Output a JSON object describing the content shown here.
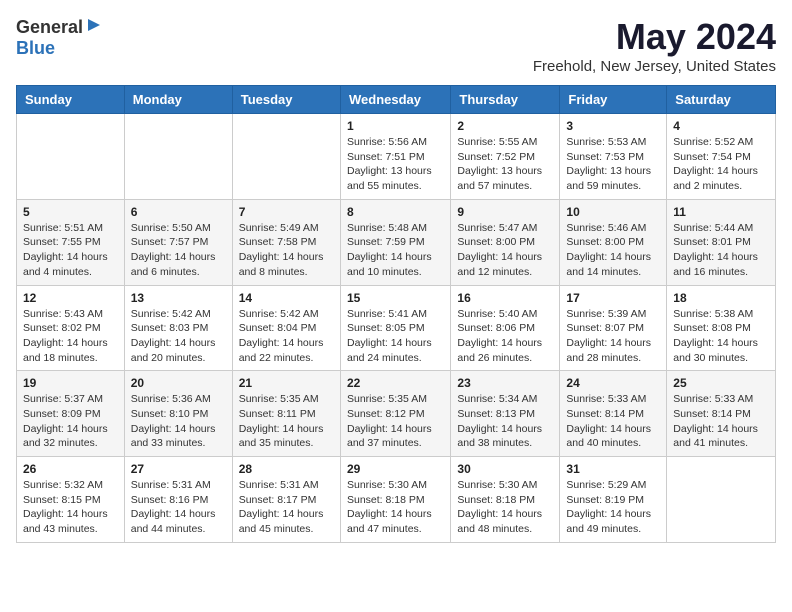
{
  "logo": {
    "general": "General",
    "blue": "Blue"
  },
  "title": "May 2024",
  "subtitle": "Freehold, New Jersey, United States",
  "weekdays": [
    "Sunday",
    "Monday",
    "Tuesday",
    "Wednesday",
    "Thursday",
    "Friday",
    "Saturday"
  ],
  "weeks": [
    [
      {
        "day": "",
        "info": ""
      },
      {
        "day": "",
        "info": ""
      },
      {
        "day": "",
        "info": ""
      },
      {
        "day": "1",
        "info": "Sunrise: 5:56 AM\nSunset: 7:51 PM\nDaylight: 13 hours\nand 55 minutes."
      },
      {
        "day": "2",
        "info": "Sunrise: 5:55 AM\nSunset: 7:52 PM\nDaylight: 13 hours\nand 57 minutes."
      },
      {
        "day": "3",
        "info": "Sunrise: 5:53 AM\nSunset: 7:53 PM\nDaylight: 13 hours\nand 59 minutes."
      },
      {
        "day": "4",
        "info": "Sunrise: 5:52 AM\nSunset: 7:54 PM\nDaylight: 14 hours\nand 2 minutes."
      }
    ],
    [
      {
        "day": "5",
        "info": "Sunrise: 5:51 AM\nSunset: 7:55 PM\nDaylight: 14 hours\nand 4 minutes."
      },
      {
        "day": "6",
        "info": "Sunrise: 5:50 AM\nSunset: 7:57 PM\nDaylight: 14 hours\nand 6 minutes."
      },
      {
        "day": "7",
        "info": "Sunrise: 5:49 AM\nSunset: 7:58 PM\nDaylight: 14 hours\nand 8 minutes."
      },
      {
        "day": "8",
        "info": "Sunrise: 5:48 AM\nSunset: 7:59 PM\nDaylight: 14 hours\nand 10 minutes."
      },
      {
        "day": "9",
        "info": "Sunrise: 5:47 AM\nSunset: 8:00 PM\nDaylight: 14 hours\nand 12 minutes."
      },
      {
        "day": "10",
        "info": "Sunrise: 5:46 AM\nSunset: 8:00 PM\nDaylight: 14 hours\nand 14 minutes."
      },
      {
        "day": "11",
        "info": "Sunrise: 5:44 AM\nSunset: 8:01 PM\nDaylight: 14 hours\nand 16 minutes."
      }
    ],
    [
      {
        "day": "12",
        "info": "Sunrise: 5:43 AM\nSunset: 8:02 PM\nDaylight: 14 hours\nand 18 minutes."
      },
      {
        "day": "13",
        "info": "Sunrise: 5:42 AM\nSunset: 8:03 PM\nDaylight: 14 hours\nand 20 minutes."
      },
      {
        "day": "14",
        "info": "Sunrise: 5:42 AM\nSunset: 8:04 PM\nDaylight: 14 hours\nand 22 minutes."
      },
      {
        "day": "15",
        "info": "Sunrise: 5:41 AM\nSunset: 8:05 PM\nDaylight: 14 hours\nand 24 minutes."
      },
      {
        "day": "16",
        "info": "Sunrise: 5:40 AM\nSunset: 8:06 PM\nDaylight: 14 hours\nand 26 minutes."
      },
      {
        "day": "17",
        "info": "Sunrise: 5:39 AM\nSunset: 8:07 PM\nDaylight: 14 hours\nand 28 minutes."
      },
      {
        "day": "18",
        "info": "Sunrise: 5:38 AM\nSunset: 8:08 PM\nDaylight: 14 hours\nand 30 minutes."
      }
    ],
    [
      {
        "day": "19",
        "info": "Sunrise: 5:37 AM\nSunset: 8:09 PM\nDaylight: 14 hours\nand 32 minutes."
      },
      {
        "day": "20",
        "info": "Sunrise: 5:36 AM\nSunset: 8:10 PM\nDaylight: 14 hours\nand 33 minutes."
      },
      {
        "day": "21",
        "info": "Sunrise: 5:35 AM\nSunset: 8:11 PM\nDaylight: 14 hours\nand 35 minutes."
      },
      {
        "day": "22",
        "info": "Sunrise: 5:35 AM\nSunset: 8:12 PM\nDaylight: 14 hours\nand 37 minutes."
      },
      {
        "day": "23",
        "info": "Sunrise: 5:34 AM\nSunset: 8:13 PM\nDaylight: 14 hours\nand 38 minutes."
      },
      {
        "day": "24",
        "info": "Sunrise: 5:33 AM\nSunset: 8:14 PM\nDaylight: 14 hours\nand 40 minutes."
      },
      {
        "day": "25",
        "info": "Sunrise: 5:33 AM\nSunset: 8:14 PM\nDaylight: 14 hours\nand 41 minutes."
      }
    ],
    [
      {
        "day": "26",
        "info": "Sunrise: 5:32 AM\nSunset: 8:15 PM\nDaylight: 14 hours\nand 43 minutes."
      },
      {
        "day": "27",
        "info": "Sunrise: 5:31 AM\nSunset: 8:16 PM\nDaylight: 14 hours\nand 44 minutes."
      },
      {
        "day": "28",
        "info": "Sunrise: 5:31 AM\nSunset: 8:17 PM\nDaylight: 14 hours\nand 45 minutes."
      },
      {
        "day": "29",
        "info": "Sunrise: 5:30 AM\nSunset: 8:18 PM\nDaylight: 14 hours\nand 47 minutes."
      },
      {
        "day": "30",
        "info": "Sunrise: 5:30 AM\nSunset: 8:18 PM\nDaylight: 14 hours\nand 48 minutes."
      },
      {
        "day": "31",
        "info": "Sunrise: 5:29 AM\nSunset: 8:19 PM\nDaylight: 14 hours\nand 49 minutes."
      },
      {
        "day": "",
        "info": ""
      }
    ]
  ]
}
